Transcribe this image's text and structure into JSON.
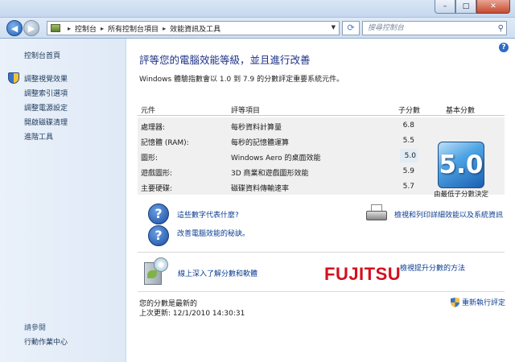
{
  "window": {
    "min_glyph": "–",
    "max_glyph": "□",
    "close_glyph": "✕"
  },
  "address": {
    "back_glyph": "◀",
    "forward_glyph": "▶",
    "crumbs": [
      "控制台",
      "所有控制台項目",
      "效能資訊及工具"
    ],
    "refresh_glyph": "⟳",
    "search_placeholder": "搜尋控制台"
  },
  "sidebar": {
    "home": "控制台首頁",
    "items": [
      {
        "label": "調整視覺效果",
        "icon": "shield-icon"
      },
      {
        "label": "調整索引選項",
        "icon": ""
      },
      {
        "label": "調整電源設定",
        "icon": ""
      },
      {
        "label": "開啟磁碟清理",
        "icon": ""
      },
      {
        "label": "進階工具",
        "icon": ""
      }
    ],
    "see_also": "請參閱",
    "action_center": "行動作業中心"
  },
  "main": {
    "title": "評等您的電腦效能等級，並且進行改善",
    "subtitle": "Windows 體驗指數會以 1.0 到 7.9 的分數評定重要系統元件。",
    "table": {
      "headers": {
        "component": "元件",
        "rated": "評等項目",
        "subscore": "子分數",
        "basescore": "基本分數"
      },
      "rows": [
        {
          "component": "處理器:",
          "rated": "每秒資料計算量",
          "subscore": "6.8"
        },
        {
          "component": "記憶體 (RAM):",
          "rated": "每秒的記憶體運算",
          "subscore": "5.5"
        },
        {
          "component": "圖形:",
          "rated": "Windows Aero 的桌面效能",
          "subscore": "5.0"
        },
        {
          "component": "遊戲圖形:",
          "rated": "3D 商業和遊戲圖形效能",
          "subscore": "5.9"
        },
        {
          "component": "主要硬碟:",
          "rated": "磁碟資料傳輸速率",
          "subscore": "5.7"
        }
      ],
      "base_score": "5.0",
      "base_caption": "由最低子分數決定"
    },
    "links": {
      "what_mean": "這些數字代表什麼?",
      "improve_tips": "改善電腦效能的秘訣。",
      "print_details": "檢視和列印詳細效能以及系統資訊"
    },
    "partner": {
      "learn_more": "線上深入了解分數和軟體",
      "brand": "FUJITSU",
      "improve_ways": "檢視提升分數的方法"
    },
    "footer": {
      "status": "您的分數是最新的",
      "last_update": "上次更新: 12/1/2010 14:30:31",
      "rerun": "重新執行評定"
    }
  }
}
